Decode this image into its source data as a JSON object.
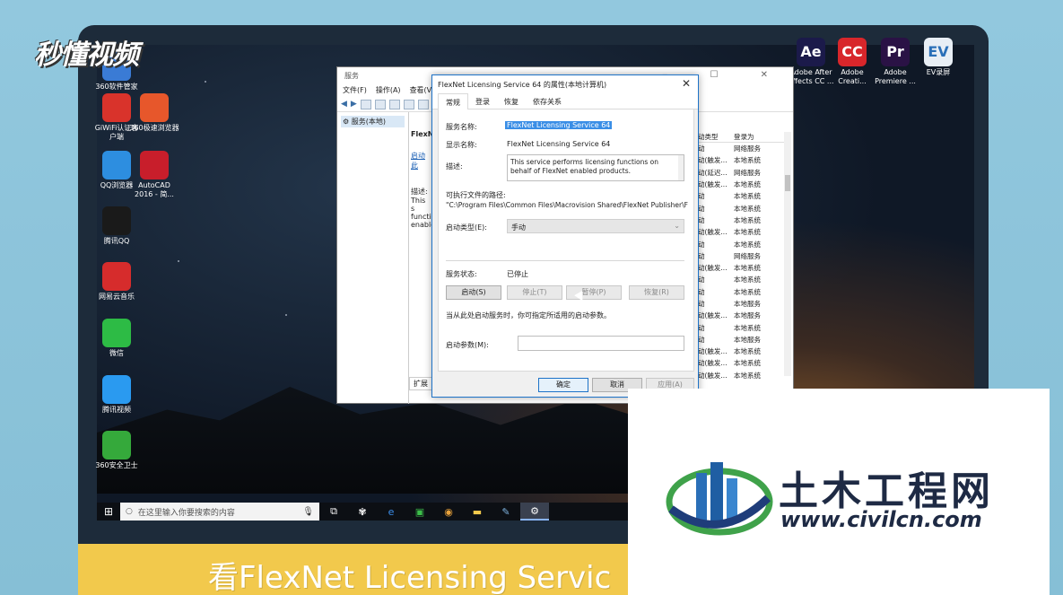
{
  "watermark_logo": "秒懂视频",
  "caption": "看FlexNet Licensing Servic",
  "civil_watermark": {
    "name": "土木工程网",
    "url": "www.civilcn.com"
  },
  "desktop_icons_left": [
    {
      "label": "360软件管家",
      "icon": "box-icon",
      "color": "#3a7bd5"
    },
    {
      "label": "GiWiFi认证客户端",
      "icon": "house-icon",
      "color": "#d9332b"
    },
    {
      "label": "360极速浏览器",
      "icon": "flower-icon",
      "color": "#e7572b"
    },
    {
      "label": "QQ浏览器",
      "icon": "browser-icon",
      "color": "#2d8ee0"
    },
    {
      "label": "AutoCAD 2016 - 简...",
      "icon": "autocad-icon",
      "color": "#c81e2b"
    },
    {
      "label": "腾讯QQ",
      "icon": "penguin-icon",
      "color": "#1a1a1a"
    },
    {
      "label": "网易云音乐",
      "icon": "music-icon",
      "color": "#d62c2c"
    },
    {
      "label": "微信",
      "icon": "wechat-icon",
      "color": "#2dbb45"
    },
    {
      "label": "腾讯视频",
      "icon": "play-icon",
      "color": "#2a9af0"
    },
    {
      "label": "360安全卫士",
      "icon": "shield-plus-icon",
      "color": "#35a93b"
    }
  ],
  "desktop_icons_right": [
    {
      "label": "Adobe After Effects CC ...",
      "badge": "Ae",
      "color": "#1b1a4a"
    },
    {
      "label": "Adobe Creati...",
      "badge": "CC",
      "color": "#d8262b"
    },
    {
      "label": "Adobe Premiere ...",
      "badge": "Pr",
      "color": "#2a1245"
    },
    {
      "label": "EV录屏",
      "badge": "EV",
      "color": "#e8eef5"
    }
  ],
  "services_window": {
    "title": "服务",
    "menu": [
      "文件(F)",
      "操作(A)",
      "查看(V)"
    ],
    "tree_item": "服务(本地)",
    "mid_texts": [
      "FlexN",
      "启动此",
      "描述:",
      "This s",
      "functi",
      "enable"
    ],
    "bottom_tab": "扩展",
    "columns": [
      "动类型",
      "登录为"
    ],
    "rows": [
      [
        "动",
        "网络服务"
      ],
      [
        "动(触发...",
        "本地系统"
      ],
      [
        "动(延迟...",
        "网络服务"
      ],
      [
        "动(触发...",
        "本地系统"
      ],
      [
        "动",
        "本地系统"
      ],
      [
        "动",
        "本地系统"
      ],
      [
        "动",
        "本地系统"
      ],
      [
        "动(触发...",
        "本地系统"
      ],
      [
        "动",
        "本地系统"
      ],
      [
        "动",
        "网络服务"
      ],
      [
        "动(触发...",
        "本地系统"
      ],
      [
        "动",
        "本地系统"
      ],
      [
        "动",
        "本地系统"
      ],
      [
        "动",
        "本地服务"
      ],
      [
        "动(触发...",
        "本地服务"
      ],
      [
        "动",
        "本地系统"
      ],
      [
        "动",
        "本地服务"
      ],
      [
        "动(触发...",
        "本地系统"
      ],
      [
        "动(触发...",
        "本地系统"
      ],
      [
        "动(触发...",
        "本地系统"
      ]
    ]
  },
  "dialog": {
    "title": "FlexNet Licensing Service 64 的属性(本地计算机)",
    "tabs": [
      "常规",
      "登录",
      "恢复",
      "依存关系"
    ],
    "service_name_label": "服务名称:",
    "service_name": "FlexNet Licensing Service 64",
    "display_name_label": "显示名称:",
    "display_name": "FlexNet Licensing Service 64",
    "description_label": "描述:",
    "description": "This service performs licensing functions on behalf of FlexNet enabled products.",
    "path_label": "可执行文件的路径:",
    "path": "\"C:\\Program Files\\Common Files\\Macrovision Shared\\FlexNet Publisher\\FNP",
    "startup_type_label": "启动类型(E):",
    "startup_type": "手动",
    "status_label": "服务状态:",
    "status": "已停止",
    "buttons": {
      "start": "启动(S)",
      "stop": "停止(T)",
      "pause": "暂停(P)",
      "resume": "恢复(R)"
    },
    "hint": "当从此处启动服务时，你可指定所适用的启动参数。",
    "params_label": "启动参数(M):",
    "ok": "确定",
    "cancel": "取消",
    "apply": "应用(A)"
  },
  "taskbar": {
    "search_placeholder": "在这里输入你要搜索的内容",
    "icons": [
      "task-view-icon",
      "fan-icon",
      "edge-icon",
      "terminal-icon",
      "color-wheel-icon",
      "folder-icon",
      "pen-icon",
      "services-gear-icon"
    ]
  }
}
